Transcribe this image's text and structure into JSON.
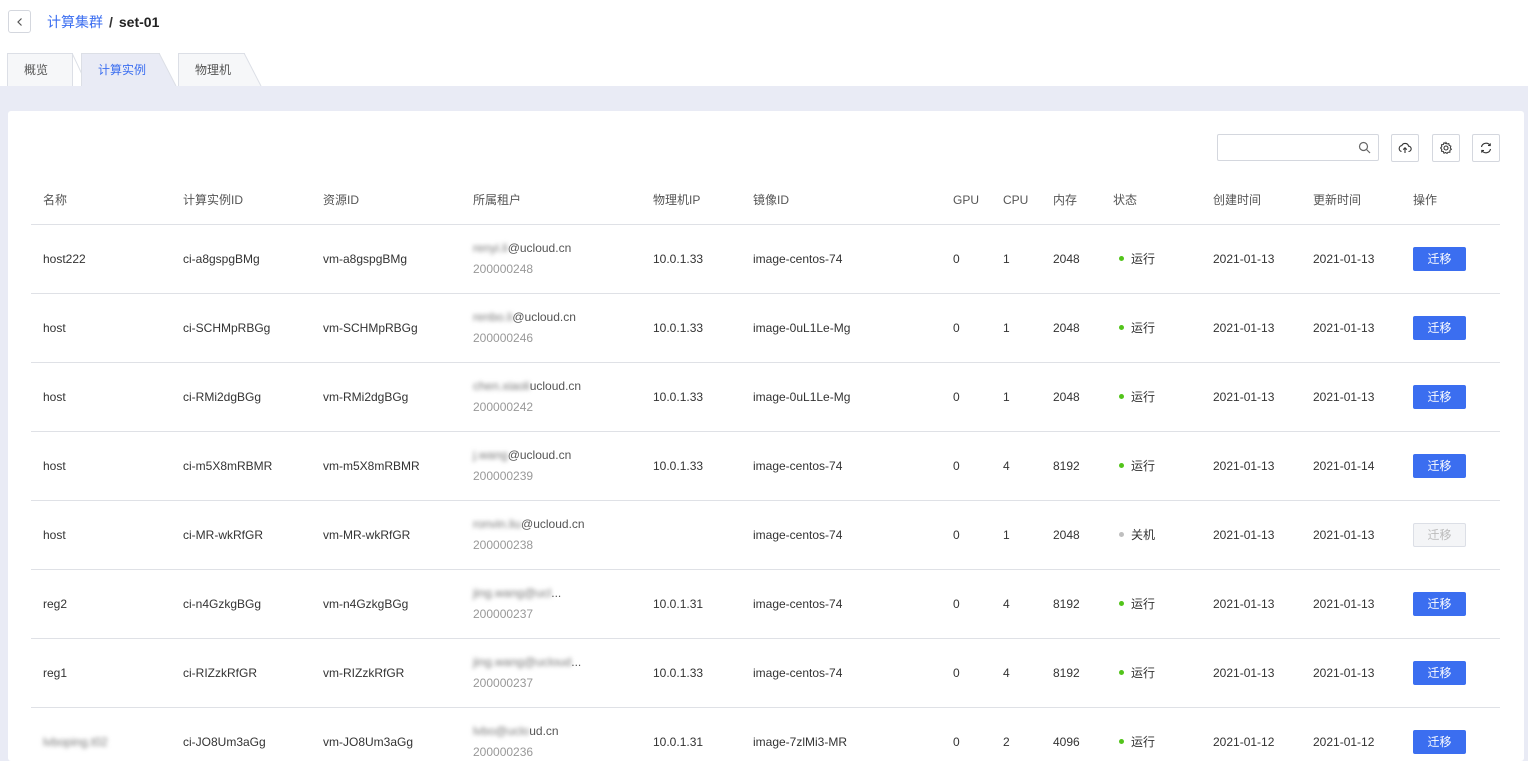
{
  "breadcrumb": {
    "parent": "计算集群",
    "separator": "/",
    "current": "set-01"
  },
  "tabs": [
    {
      "label": "概览",
      "active": false
    },
    {
      "label": "计算实例",
      "active": true
    },
    {
      "label": "物理机",
      "active": false
    }
  ],
  "toolbar": {
    "search_placeholder": "",
    "search_icon": "search-icon",
    "buttons": [
      "cloud-upload-icon",
      "gear-icon",
      "refresh-icon"
    ]
  },
  "colors": {
    "accent": "#3b6ef0",
    "running": "#52c41a",
    "stopped": "#bfbfbf",
    "page_bg": "#e9ebf5"
  },
  "table": {
    "columns": [
      "名称",
      "计算实例ID",
      "资源ID",
      "所属租户",
      "物理机IP",
      "镜像ID",
      "GPU",
      "CPU",
      "内存",
      "状态",
      "创建时间",
      "更新时间",
      "操作"
    ],
    "rows": [
      {
        "name": "host222",
        "instance_id": "ci-a8gspgBMg",
        "resource_id": "vm-a8gspgBMg",
        "tenant_email_masked": "renyi.li",
        "tenant_email_domain": "@ucloud.cn",
        "tenant_id": "200000248",
        "host_ip": "10.0.1.33",
        "image_id": "image-centos-74",
        "gpu": "0",
        "cpu": "1",
        "memory": "2048",
        "status": "运行",
        "running": true,
        "created": "2021-01-13",
        "updated": "2021-01-13",
        "action": "迁移",
        "action_enabled": true
      },
      {
        "name": "host",
        "instance_id": "ci-SCHMpRBGg",
        "resource_id": "vm-SCHMpRBGg",
        "tenant_email_masked": "renbo.li",
        "tenant_email_domain": "@ucloud.cn",
        "tenant_id": "200000246",
        "host_ip": "10.0.1.33",
        "image_id": "image-0uL1Le-Mg",
        "gpu": "0",
        "cpu": "1",
        "memory": "2048",
        "status": "运行",
        "running": true,
        "created": "2021-01-13",
        "updated": "2021-01-13",
        "action": "迁移",
        "action_enabled": true
      },
      {
        "name": "host",
        "instance_id": "ci-RMi2dgBGg",
        "resource_id": "vm-RMi2dgBGg",
        "tenant_email_masked": "chen.xiaoli",
        "tenant_email_domain": "ucloud.cn",
        "tenant_id": "200000242",
        "host_ip": "10.0.1.33",
        "image_id": "image-0uL1Le-Mg",
        "gpu": "0",
        "cpu": "1",
        "memory": "2048",
        "status": "运行",
        "running": true,
        "created": "2021-01-13",
        "updated": "2021-01-13",
        "action": "迁移",
        "action_enabled": true
      },
      {
        "name": "host",
        "instance_id": "ci-m5X8mRBMR",
        "resource_id": "vm-m5X8mRBMR",
        "tenant_email_masked": "j.wang",
        "tenant_email_domain": "@ucloud.cn",
        "tenant_id": "200000239",
        "host_ip": "10.0.1.33",
        "image_id": "image-centos-74",
        "gpu": "0",
        "cpu": "4",
        "memory": "8192",
        "status": "运行",
        "running": true,
        "created": "2021-01-13",
        "updated": "2021-01-14",
        "action": "迁移",
        "action_enabled": true
      },
      {
        "name": "host",
        "instance_id": "ci-MR-wkRfGR",
        "resource_id": "vm-MR-wkRfGR",
        "tenant_email_masked": "ronvin.liu",
        "tenant_email_domain": "@ucloud.cn",
        "tenant_id": "200000238",
        "host_ip": "",
        "image_id": "image-centos-74",
        "gpu": "0",
        "cpu": "1",
        "memory": "2048",
        "status": "关机",
        "running": false,
        "created": "2021-01-13",
        "updated": "2021-01-13",
        "action": "迁移",
        "action_enabled": false
      },
      {
        "name": "reg2",
        "instance_id": "ci-n4GzkgBGg",
        "resource_id": "vm-n4GzkgBGg",
        "tenant_email_masked": "jing.wang@ucl",
        "tenant_email_domain": "...",
        "tenant_id": "200000237",
        "host_ip": "10.0.1.31",
        "image_id": "image-centos-74",
        "gpu": "0",
        "cpu": "4",
        "memory": "8192",
        "status": "运行",
        "running": true,
        "created": "2021-01-13",
        "updated": "2021-01-13",
        "action": "迁移",
        "action_enabled": true
      },
      {
        "name": "reg1",
        "instance_id": "ci-RIZzkRfGR",
        "resource_id": "vm-RIZzkRfGR",
        "tenant_email_masked": "jing.wang@ucloud",
        "tenant_email_domain": "...",
        "tenant_id": "200000237",
        "host_ip": "10.0.1.33",
        "image_id": "image-centos-74",
        "gpu": "0",
        "cpu": "4",
        "memory": "8192",
        "status": "运行",
        "running": true,
        "created": "2021-01-13",
        "updated": "2021-01-13",
        "action": "迁移",
        "action_enabled": true
      },
      {
        "name": "lvboping.t02",
        "instance_id": "ci-JO8Um3aGg",
        "resource_id": "vm-JO8Um3aGg",
        "tenant_email_masked": "lvbo@uclo",
        "tenant_email_domain": "ud.cn",
        "tenant_id": "200000236",
        "host_ip": "10.0.1.31",
        "image_id": "image-7zlMi3-MR",
        "gpu": "0",
        "cpu": "2",
        "memory": "4096",
        "status": "运行",
        "running": true,
        "created": "2021-01-12",
        "updated": "2021-01-12",
        "action": "迁移",
        "action_enabled": true
      }
    ]
  }
}
